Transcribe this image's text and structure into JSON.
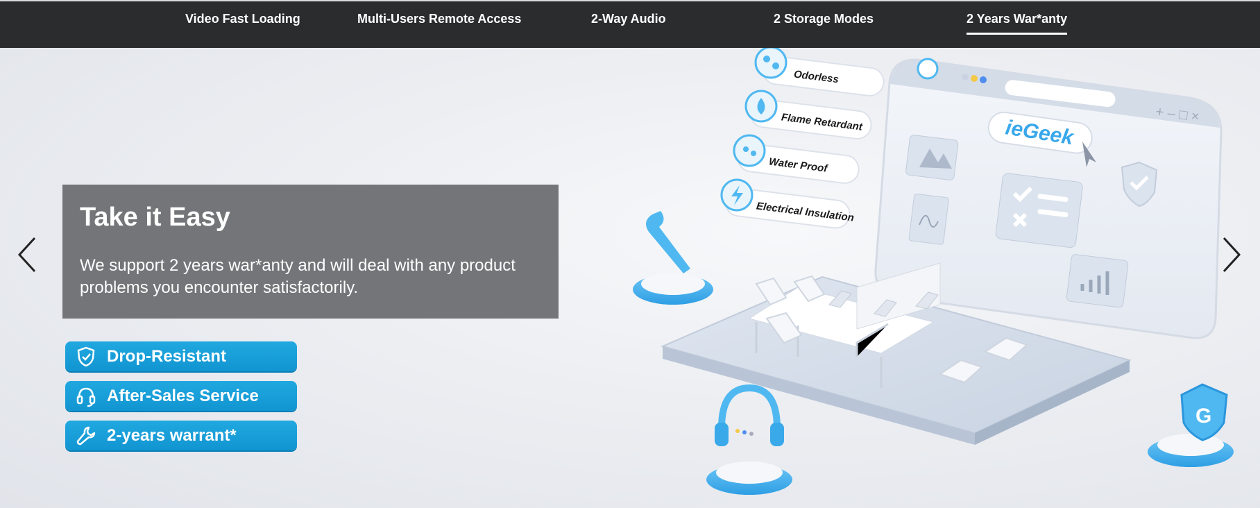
{
  "tabs": [
    {
      "label": "Video Fast Loading",
      "active": false
    },
    {
      "label": "Multi-Users Remote Access",
      "active": false
    },
    {
      "label": "2-Way Audio",
      "active": false
    },
    {
      "label": "2 Storage Modes",
      "active": false
    },
    {
      "label": "2 Years War*anty",
      "active": true
    }
  ],
  "hero": {
    "title": "Take it Easy",
    "description": "We support 2 years war*anty and will deal with any product problems you encounter satisfactorily.",
    "badges": [
      {
        "label": "Drop-Resistant",
        "icon": "shield-check-icon"
      },
      {
        "label": "After-Sales Service",
        "icon": "headset-icon"
      },
      {
        "label": "2-years warrant*",
        "icon": "wrench-icon"
      }
    ],
    "feature_pills": [
      {
        "label": "Odorless",
        "icon": "molecule-icon"
      },
      {
        "label": "Flame Retardant",
        "icon": "flame-icon"
      },
      {
        "label": "Water Proof",
        "icon": "droplets-icon"
      },
      {
        "label": "Electrical Insulation",
        "icon": "lightning-icon"
      }
    ],
    "brand_logo": "ieGeek"
  },
  "carousel": {
    "prev_icon": "chevron-left-icon",
    "next_icon": "chevron-right-icon"
  },
  "colors": {
    "topbar": "#2b2c2e",
    "caption_bg": "#6e6f72",
    "badge_blue": "#1ba0da",
    "accent_blue": "#4fb8f0"
  }
}
